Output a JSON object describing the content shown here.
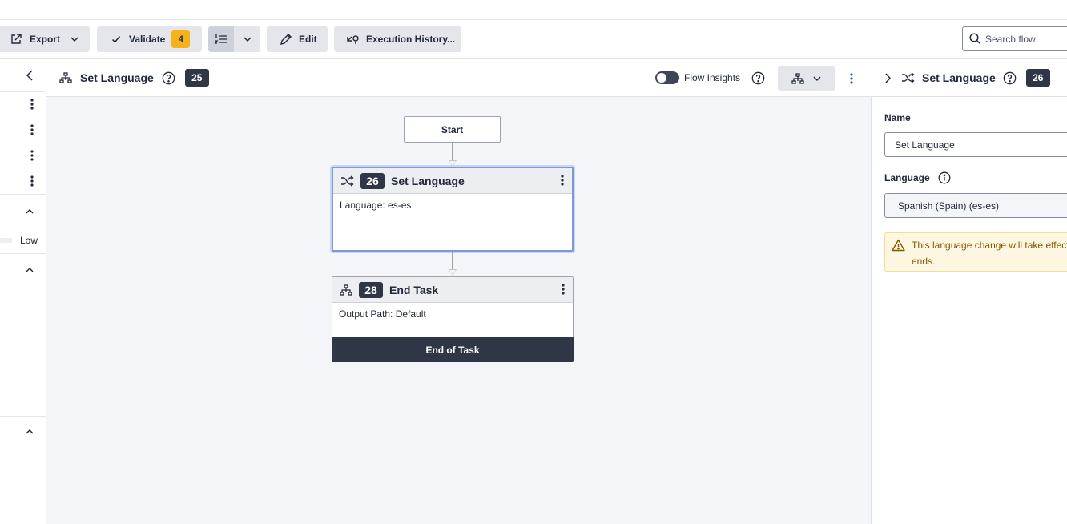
{
  "toolbar": {
    "export_label": "Export",
    "validate_label": "Validate",
    "validate_count": "4",
    "edit_label": "Edit",
    "history_label": "Execution History...",
    "search_placeholder": "Search flow"
  },
  "left_panel": {
    "priority_label": "Low"
  },
  "canvas_header": {
    "title": "Set Language",
    "id_badge": "25",
    "insights_label": "Flow Insights"
  },
  "flow": {
    "start_label": "Start",
    "nodes": [
      {
        "id": "26",
        "title": "Set Language",
        "body": "Language: es-es"
      },
      {
        "id": "28",
        "title": "End Task",
        "body": "Output Path: Default",
        "footer": "End of Task"
      }
    ]
  },
  "right_panel": {
    "title": "Set Language",
    "id_badge": "26",
    "name_label": "Name",
    "name_value": "Set Language",
    "language_label": "Language",
    "language_value": "Spanish (Spain) (es-es)",
    "warning_text": "This language change will take effect",
    "warning_text_2": "ends."
  },
  "colors": {
    "dark_badge": "#2f3747",
    "validate_badge": "#f6b21b",
    "selection_border": "#7b98d7",
    "warning_bg": "#fdf6e0",
    "warning_text": "#7d5a00"
  }
}
